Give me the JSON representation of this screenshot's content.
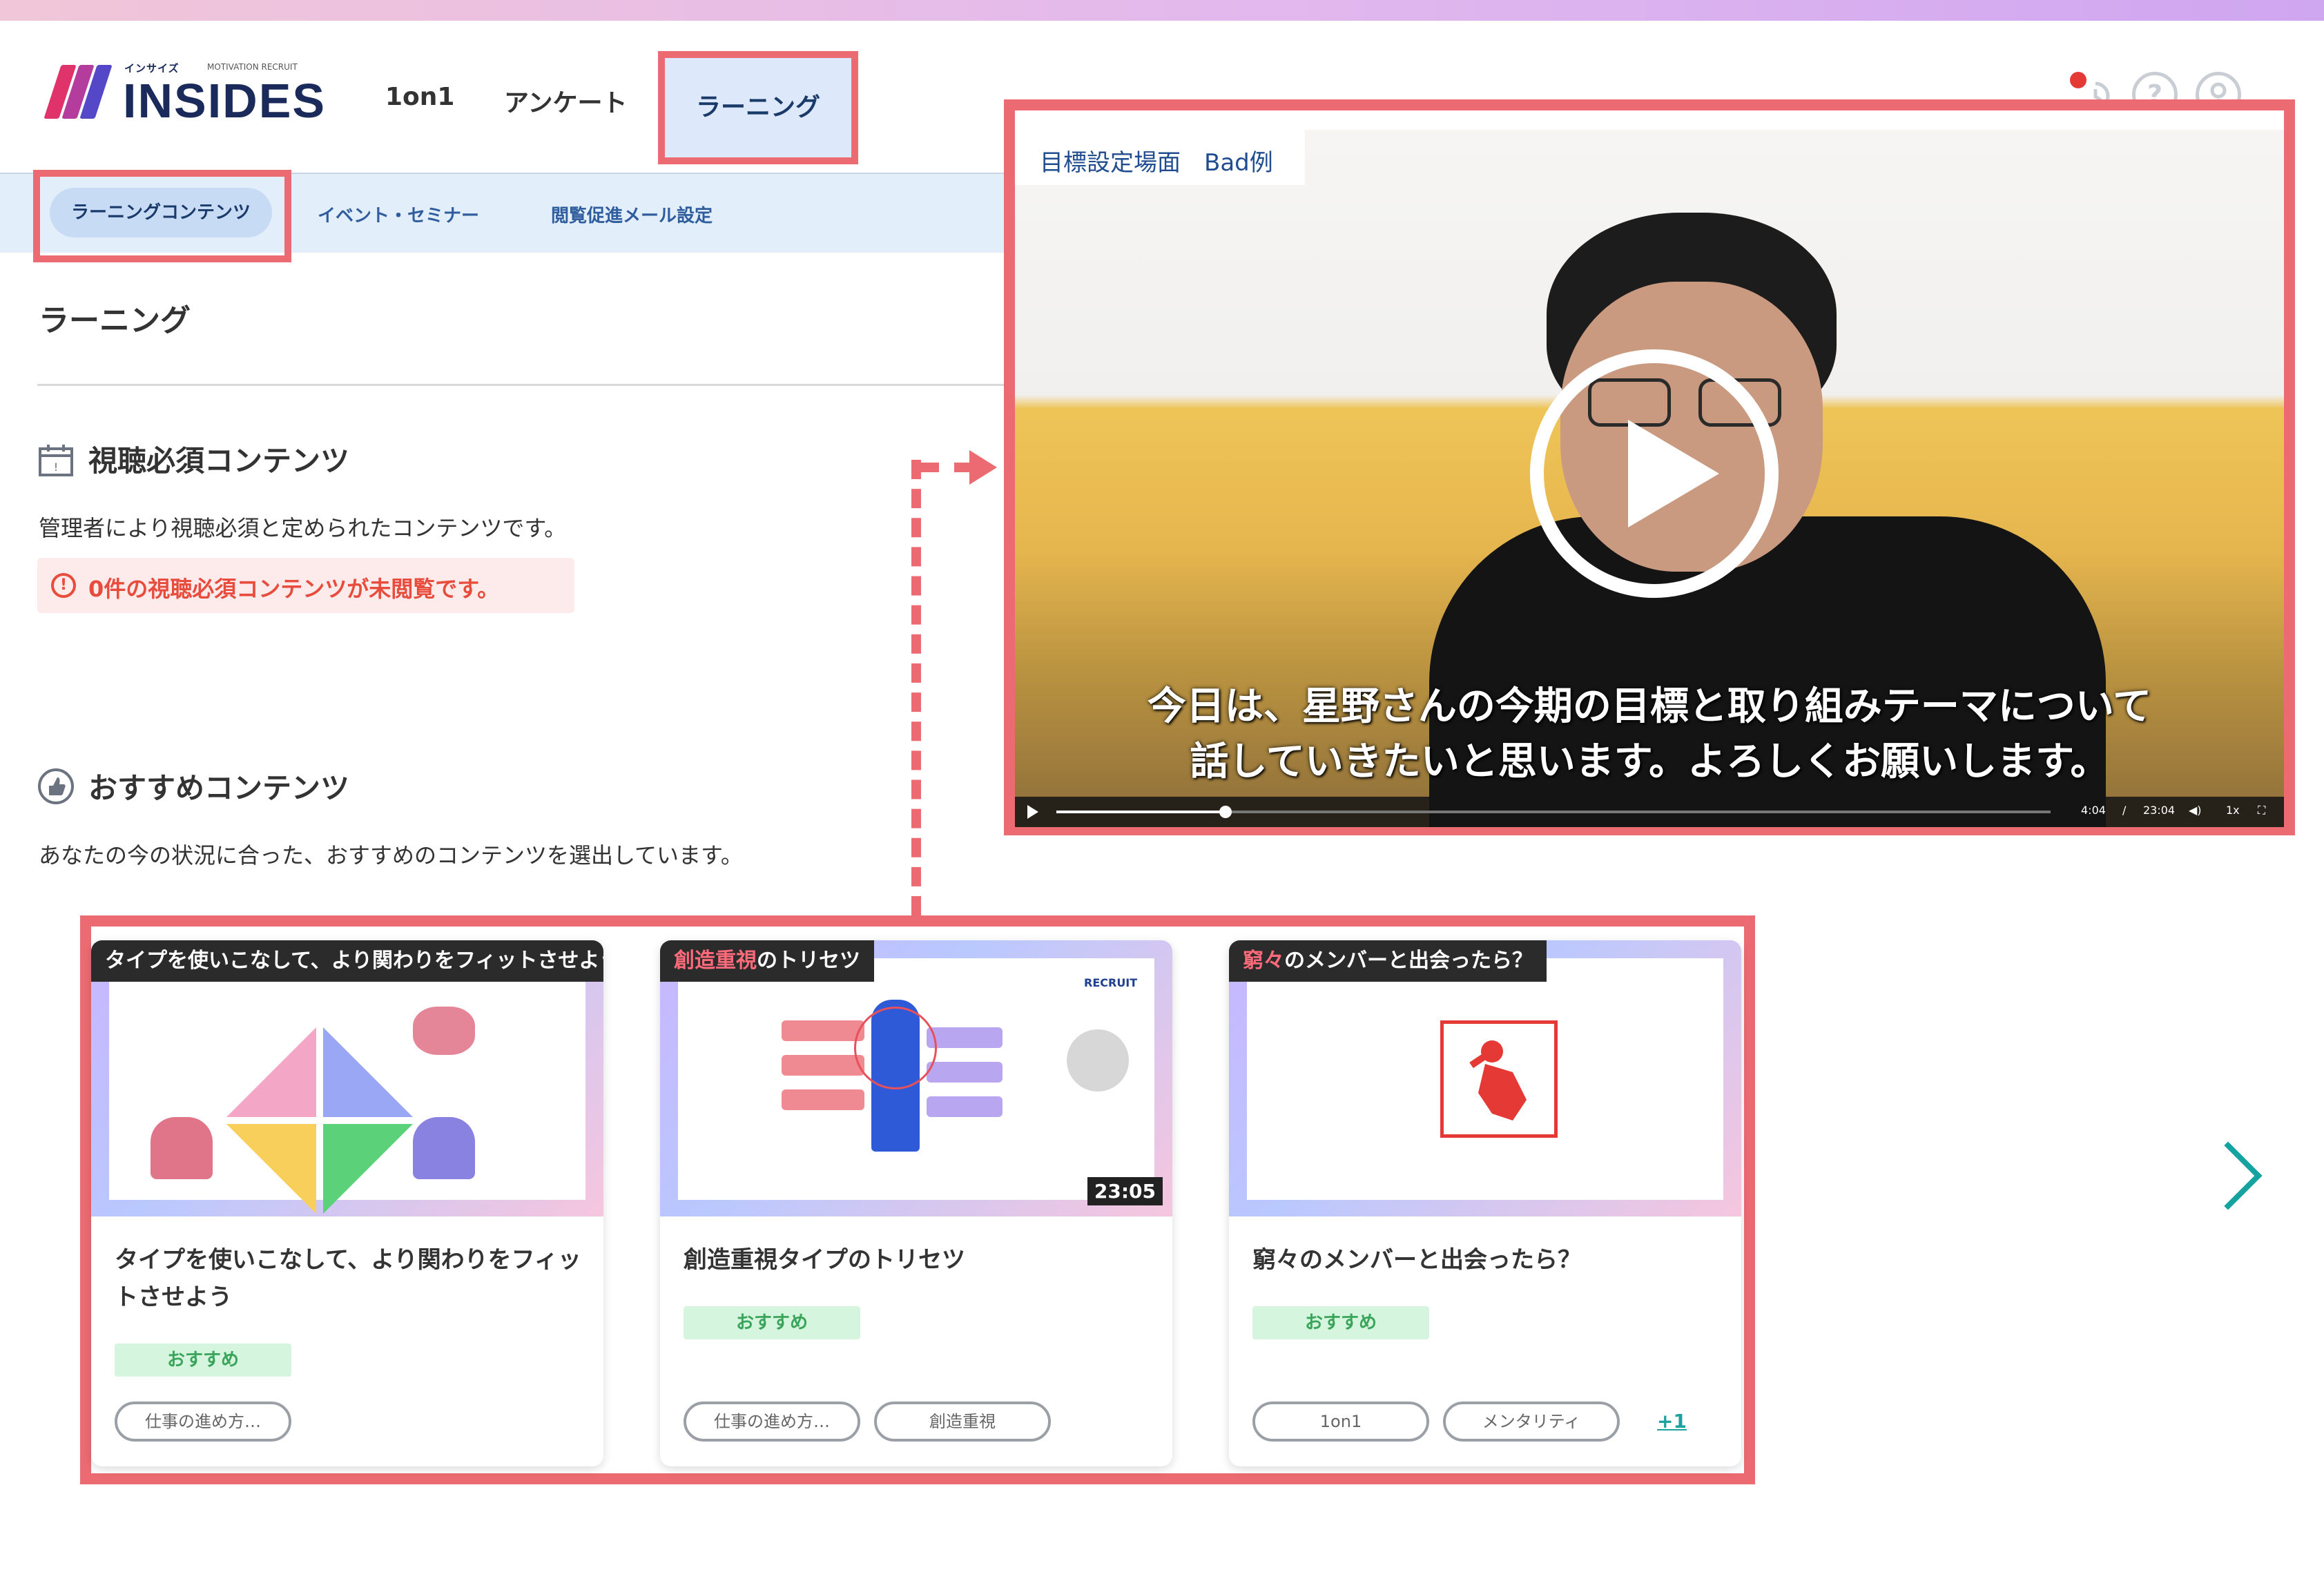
{
  "brand": {
    "logo_text": "INSIDES",
    "logo_kana": "インサイズ",
    "logo_partner": "MOTIVATION RECRUIT"
  },
  "nav": {
    "tabs": [
      {
        "label": "1on1"
      },
      {
        "label": "アンケート"
      },
      {
        "label": "ラーニング",
        "active": true
      }
    ]
  },
  "header_icons": [
    "history-icon",
    "help-icon",
    "user-icon"
  ],
  "subnav": {
    "items": [
      {
        "label": "ラーニングコンテンツ",
        "active": true
      },
      {
        "label": "イベント・セミナー"
      },
      {
        "label": "閲覧促進メール設定"
      }
    ]
  },
  "page": {
    "title": "ラーニング"
  },
  "required_section": {
    "title": "視聴必須コンテンツ",
    "description": "管理者により視聴必須と定められたコンテンツです。",
    "alert": "0件の視聴必須コンテンツが未閲覧です。"
  },
  "recommended_section": {
    "title": "おすすめコンテンツ",
    "description": "あなたの今の状況に合った、おすすめのコンテンツを選出しています。"
  },
  "video": {
    "header": "目標設定場面　Bad例",
    "subtitle_line1": "今日は、星野さんの今期の目標と取り組みテーマについて",
    "subtitle_line2": "話していきたいと思います。よろしくお願いします。",
    "progress": 0.17,
    "current_time": "4:04",
    "separator": "/",
    "duration": "23:04",
    "speed": "1x"
  },
  "cards": [
    {
      "thumb_label": "タイプを使いこなして、より関わりをフィットさせよう",
      "thumb_label_accent": "",
      "thumb_label_rest": "",
      "title": "タイプを使いこなして、より関わりをフィットさせよう",
      "badge": "おすすめ",
      "tags": [
        "仕事の進め方…"
      ],
      "duration": "",
      "more": ""
    },
    {
      "thumb_label": "",
      "thumb_label_accent": "創造重視",
      "thumb_label_rest": "のトリセツ",
      "title": "創造重視タイプのトリセツ",
      "badge": "おすすめ",
      "tags": [
        "仕事の進め方…",
        "創造重視"
      ],
      "duration": "23:05",
      "brand_mark": "RECRUIT",
      "more": ""
    },
    {
      "thumb_label": "",
      "thumb_label_accent": "窮々",
      "thumb_label_rest": "のメンバーと出会ったら？",
      "title": "窮々のメンバーと出会ったら？",
      "badge": "おすすめ",
      "tags": [
        "1on1",
        "メンタリティ"
      ],
      "duration": "",
      "more": "+1"
    }
  ],
  "colors": {
    "highlight": "#ec6b72",
    "accent_teal": "#14a3a0",
    "subnav_bg": "#e3eefb",
    "badge_bg": "#d6f5df",
    "badge_text": "#3aa55a",
    "alert_text": "#e74c3c"
  }
}
